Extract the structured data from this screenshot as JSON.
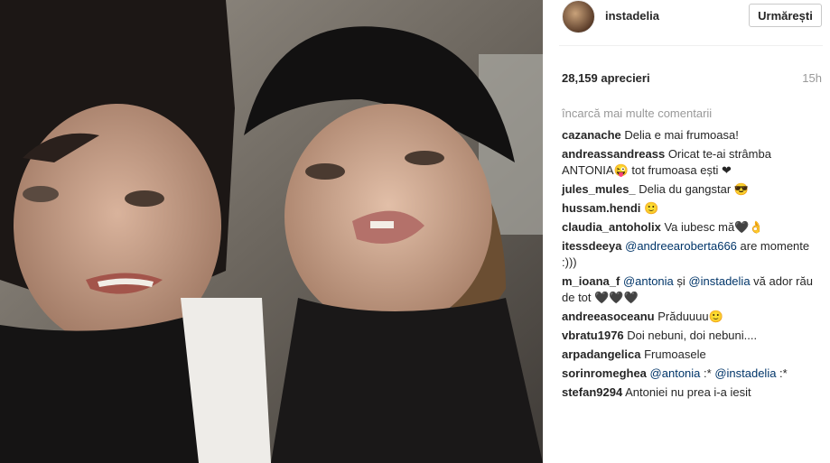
{
  "post": {
    "username": "instadelia",
    "follow_label": "Urmărești",
    "likes": "28,159 aprecieri",
    "time": "15h",
    "load_more": "încarcă mai multe comentarii"
  },
  "comments": [
    {
      "user": "cazanache",
      "text": "Delia e mai frumoasa!"
    },
    {
      "user": "andreassandreass",
      "text": "Oricat te-ai strâmba ANTONIA😜 tot frumoasa ești ❤"
    },
    {
      "user": "jules_mules_",
      "text": "Delia du gangstar 😎"
    },
    {
      "user": "hussam.hendi",
      "text": "🙂"
    },
    {
      "user": "claudia_antoholix",
      "text": "Va iubesc mă🖤👌"
    },
    {
      "user": "itessdeeya",
      "mention": "@andreearoberta666",
      "text": " are momente :)))"
    },
    {
      "user": "m_ioana_f",
      "mention": "@antonia",
      "text": " și ",
      "mention2": "@instadelia",
      "text2": " vă ador rău de tot 🖤🖤🖤"
    },
    {
      "user": "andreeasoceanu",
      "text": "Prăduuuu🙂"
    },
    {
      "user": "vbratu1976",
      "text": "Doi nebuni, doi nebuni...."
    },
    {
      "user": "arpadangelica",
      "text": "Frumoasele"
    },
    {
      "user": "sorinromeghea",
      "mention": "@antonia",
      "text": " :* ",
      "mention2": "@instadelia",
      "text2": " :*"
    },
    {
      "user": "stefan9294",
      "text": "Antoniei nu prea i-a iesit"
    }
  ],
  "colors": {
    "mention": "#003569",
    "muted": "#999999",
    "text": "#262626"
  },
  "icons": {
    "avatar": "profile-photo"
  }
}
